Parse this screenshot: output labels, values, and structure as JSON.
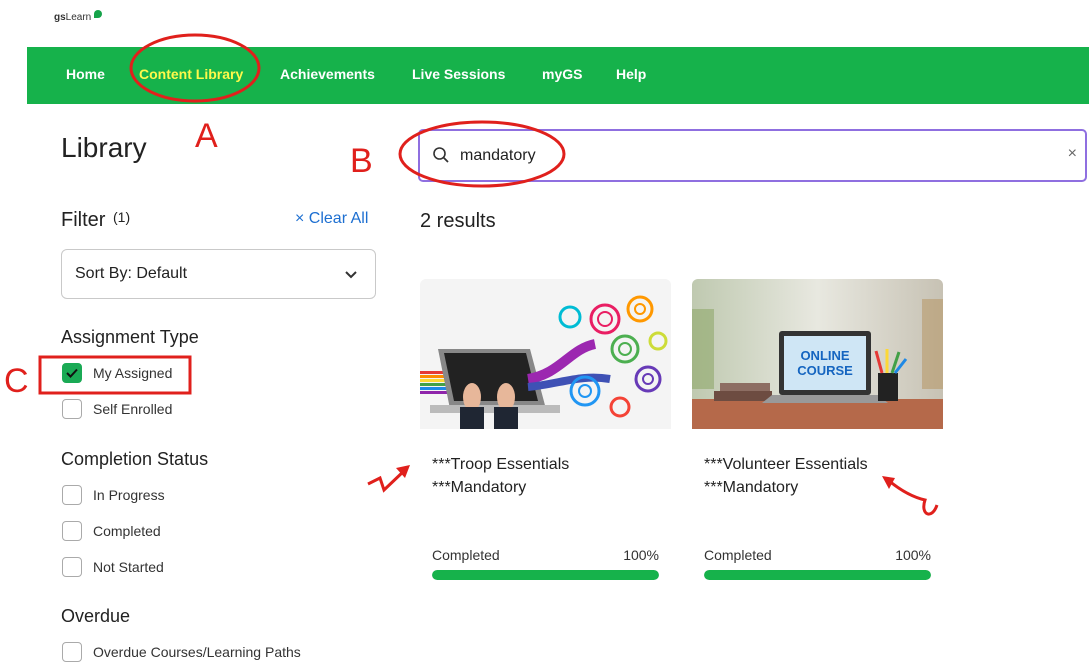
{
  "logo": {
    "bold": "gs",
    "rest": "Learn"
  },
  "nav": {
    "items": [
      {
        "label": "Home"
      },
      {
        "label": "Content Library"
      },
      {
        "label": "Achievements"
      },
      {
        "label": "Live Sessions"
      },
      {
        "label": "myGS"
      },
      {
        "label": "Help"
      }
    ],
    "active_index": 1
  },
  "sidebar": {
    "title": "Library",
    "filter_label": "Filter",
    "filter_count": "(1)",
    "clear_all": "Clear All",
    "clear_icon": "×",
    "sort_label": "Sort By: Default",
    "assignment_type": {
      "title": "Assignment Type",
      "options": [
        {
          "label": "My Assigned",
          "checked": true
        },
        {
          "label": "Self Enrolled",
          "checked": false
        }
      ]
    },
    "completion_status": {
      "title": "Completion Status",
      "options": [
        {
          "label": "In Progress",
          "checked": false
        },
        {
          "label": "Completed",
          "checked": false
        },
        {
          "label": "Not Started",
          "checked": false
        }
      ]
    },
    "overdue": {
      "title": "Overdue",
      "options": [
        {
          "label": "Overdue Courses/Learning Paths",
          "checked": false
        }
      ]
    }
  },
  "search": {
    "value": "mandatory",
    "clear_icon": "×"
  },
  "results_label": "2 results",
  "cards": [
    {
      "title_line1": "***Troop Essentials",
      "title_line2": "***Mandatory",
      "status": "Completed",
      "percent_label": "100%",
      "progress": 1.0
    },
    {
      "title_line1": "***Volunteer Essentials",
      "title_line2": "***Mandatory",
      "status": "Completed",
      "percent_label": "100%",
      "progress": 1.0,
      "thumb_text_1": "ONLINE",
      "thumb_text_2": "COURSE"
    }
  ],
  "annotations": {
    "a": "A",
    "b": "B",
    "c": "C",
    "color": "#e0201c"
  },
  "colors": {
    "nav": "#16b24b",
    "active_nav": "#fff94a",
    "link": "#1d6fd1",
    "search_border": "#8f6fe0"
  }
}
